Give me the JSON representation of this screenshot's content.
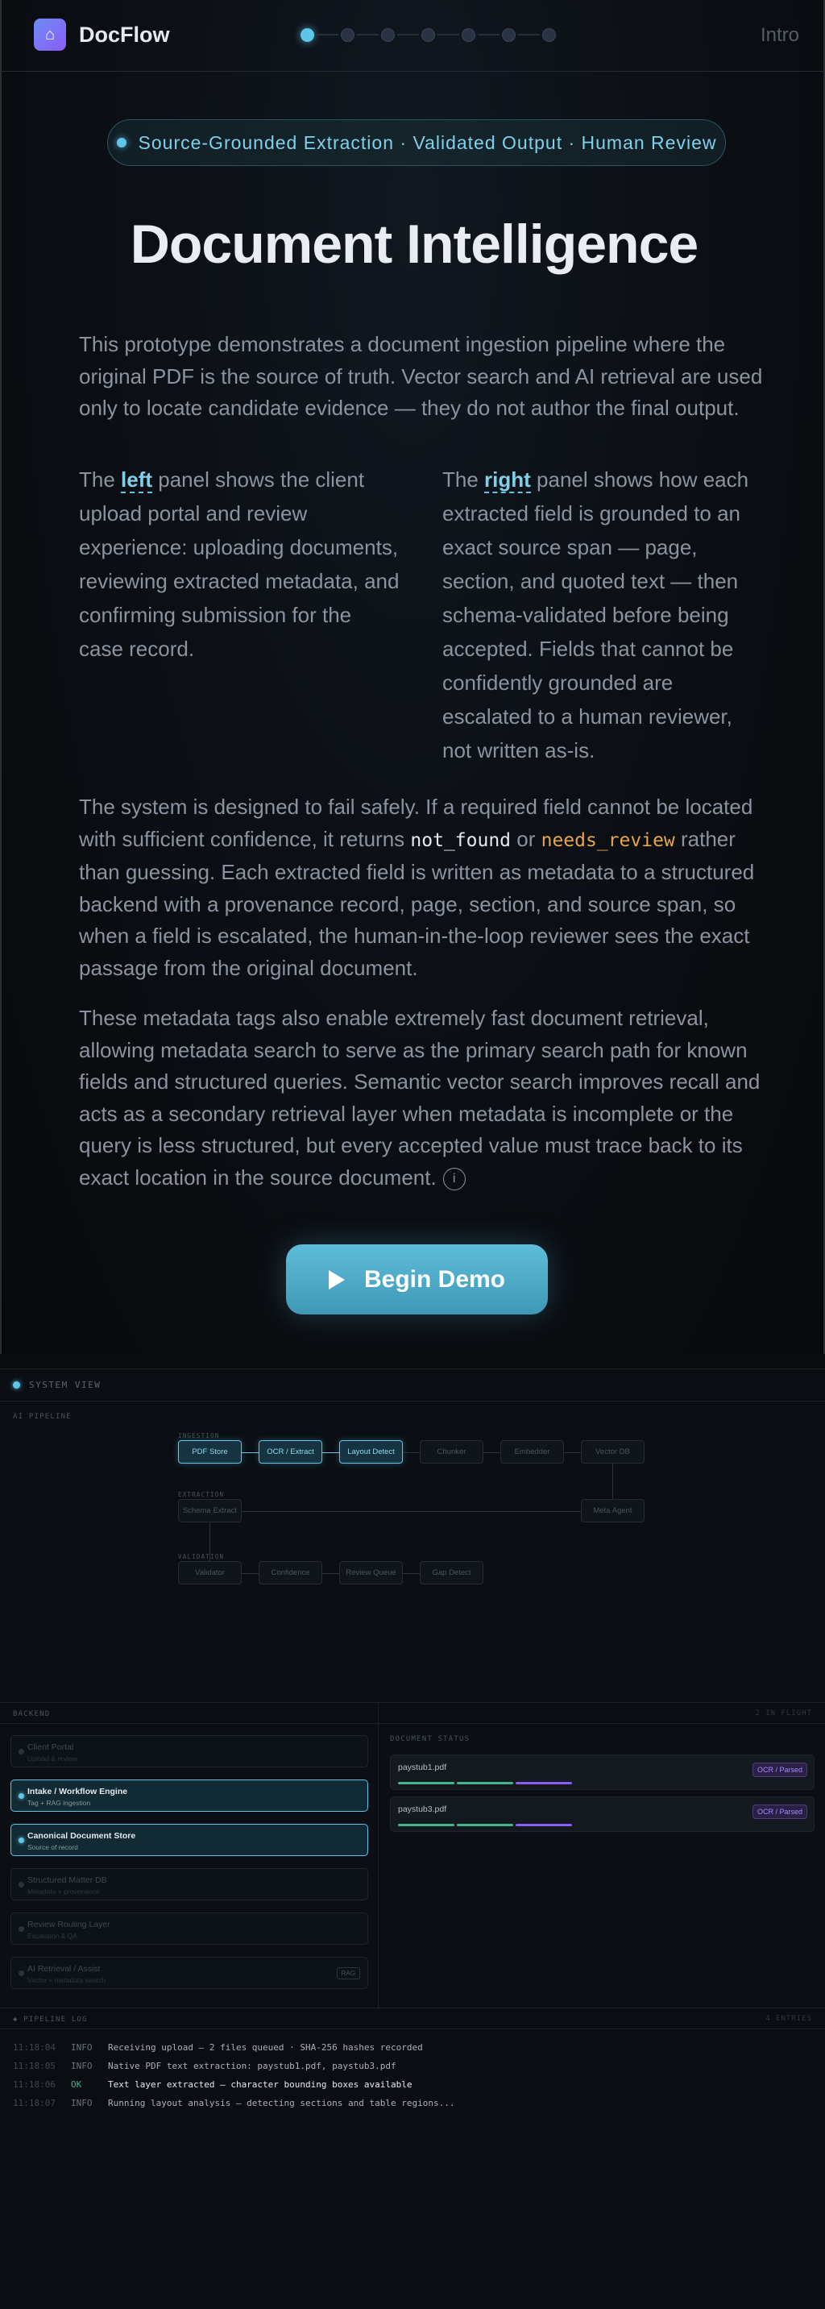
{
  "nav": {
    "logo_icon": "home-icon",
    "brand": "DocFlow",
    "current_step": "Intro",
    "steps_count": 7,
    "active_step": 0
  },
  "hero": {
    "pill": "Source-Grounded Extraction · Validated Output · Human Review",
    "title": "Document Intelligence",
    "p1": "This prototype demonstrates a document ingestion pipeline where the original PDF is the source of truth. Vector search and AI retrieval are used only to locate candidate evidence — they do not author the final output.",
    "left_pre": "The ",
    "left_hl": "left",
    "left_post": " panel shows the client upload portal and review experience: uploading documents, reviewing extracted metadata, and confirming submission for the case record.",
    "right_pre": "The ",
    "right_hl": "right",
    "right_post": " panel shows how each extracted field is grounded to an exact source span — page, section, and quoted text — then schema-validated before being accepted. Fields that cannot be confidently grounded are escalated to a human reviewer, not written as-is.",
    "p3_a": "The system is designed to fail safely. If a required field cannot be located with sufficient confidence, it returns ",
    "p3_code1": "not_found",
    "p3_b": " or ",
    "p3_code2": "needs_review",
    "p3_c": " rather than guessing. Each extracted field is written as metadata to a structured backend with a provenance record, page, section, and source span, so when a field is escalated, the human-in-the-loop reviewer sees the exact passage from the original document.",
    "p4": "These metadata tags also enable extremely fast document retrieval, allowing metadata search to serve as the primary search path for known fields and structured queries. Semantic vector search improves recall and acts as a secondary retrieval layer when metadata is incomplete or the query is less structured, but every accepted value must trace back to its exact location in the source document.",
    "info_icon": "i",
    "cta": "Begin Demo"
  },
  "system": {
    "title": "SYSTEM VIEW",
    "pipeline_label": "AI PIPELINE",
    "groups": {
      "ingestion": "INGESTION",
      "extraction": "EXTRACTION",
      "validation": "VALIDATION"
    },
    "row1": [
      "PDF Store",
      "OCR / Extract",
      "Layout Detect",
      "Chunker",
      "Embedder",
      "Vector DB"
    ],
    "row2": [
      "Schema Extract",
      "Meta Agent"
    ],
    "row3": [
      "Validator",
      "Confidence",
      "Review Queue",
      "Gap Detect"
    ],
    "backend_label": "BACKEND",
    "backend_right": "2 IN FLIGHT",
    "backend_items": [
      {
        "name": "Client Portal",
        "sub": "Upload & review",
        "active": false
      },
      {
        "name": "Intake / Workflow Engine",
        "sub": "Tag + RAG ingestion",
        "active": true
      },
      {
        "name": "Canonical Document Store",
        "sub": "Source of record",
        "active": true
      },
      {
        "name": "Structured Matter DB",
        "sub": "Metadata + provenance",
        "active": false
      },
      {
        "name": "Review Routing Layer",
        "sub": "Escalation & QA",
        "active": false
      },
      {
        "name": "AI Retrieval / Assist",
        "sub": "Vector + metadata search",
        "active": false,
        "badge": "RAG"
      }
    ],
    "docstatus_label": "DOCUMENT STATUS",
    "docs": [
      {
        "name": "paystub1.pdf",
        "status": "OCR / Parsed"
      },
      {
        "name": "paystub3.pdf",
        "status": "OCR / Parsed"
      }
    ],
    "log_label": "PIPELINE LOG",
    "log_right": "4 ENTRIES",
    "log": [
      {
        "time": "11:18:04",
        "level": "INFO",
        "msg": "Receiving upload — 2 files queued · SHA-256 hashes recorded"
      },
      {
        "time": "11:18:05",
        "level": "INFO",
        "msg": "Native PDF text extraction: paystub1.pdf, paystub3.pdf"
      },
      {
        "time": "11:18:06",
        "level": "OK",
        "msg": "Text layer extracted — character bounding boxes available"
      },
      {
        "time": "11:18:07",
        "level": "INFO",
        "msg": "Running layout analysis — detecting sections and table regions..."
      }
    ]
  },
  "colors": {
    "accent": "#5ec4e8",
    "warn": "#e6a64a",
    "purple": "#a78bfa",
    "green": "#3fb68b"
  }
}
